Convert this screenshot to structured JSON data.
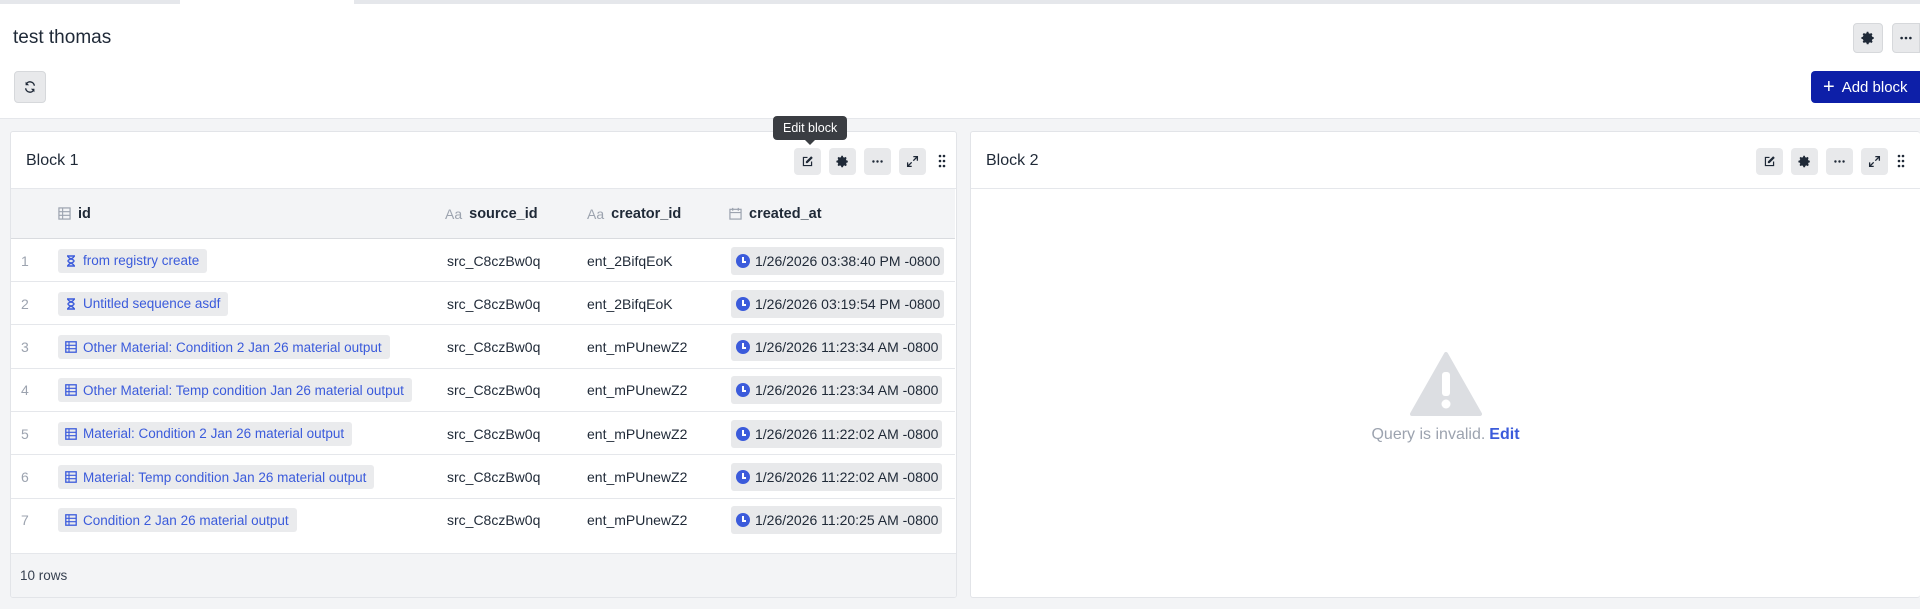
{
  "page": {
    "title": "test thomas",
    "add_block_label": "Add block",
    "accent": "#0d1fa8"
  },
  "tooltip": "Edit block",
  "block1": {
    "title": "Block 1",
    "columns": [
      {
        "label": "id",
        "icon": "table-icon"
      },
      {
        "label": "source_id",
        "icon": "text-type-icon"
      },
      {
        "label": "creator_id",
        "icon": "text-type-icon"
      },
      {
        "label": "created_at",
        "icon": "calendar-icon"
      }
    ],
    "rows": [
      {
        "num": "1",
        "id": "from registry create",
        "id_icon": "hourglass-icon",
        "source_id": "src_C8czBw0q",
        "creator_id": "ent_2BifqEoK",
        "created_at": "1/26/2026 03:38:40 PM -0800"
      },
      {
        "num": "2",
        "id": "Untitled sequence asdf",
        "id_icon": "hourglass-icon",
        "source_id": "src_C8czBw0q",
        "creator_id": "ent_2BifqEoK",
        "created_at": "1/26/2026 03:19:54 PM -0800"
      },
      {
        "num": "3",
        "id": "Other Material: Condition 2 Jan 26 material output",
        "id_icon": "table-icon",
        "source_id": "src_C8czBw0q",
        "creator_id": "ent_mPUnewZ2",
        "created_at": "1/26/2026 11:23:34 AM -0800"
      },
      {
        "num": "4",
        "id": "Other Material: Temp condition Jan 26 material output",
        "id_icon": "table-icon",
        "source_id": "src_C8czBw0q",
        "creator_id": "ent_mPUnewZ2",
        "created_at": "1/26/2026 11:23:34 AM -0800"
      },
      {
        "num": "5",
        "id": "Material: Condition 2 Jan 26 material output",
        "id_icon": "table-icon",
        "source_id": "src_C8czBw0q",
        "creator_id": "ent_mPUnewZ2",
        "created_at": "1/26/2026 11:22:02 AM -0800"
      },
      {
        "num": "6",
        "id": "Material: Temp condition Jan 26 material output",
        "id_icon": "table-icon",
        "source_id": "src_C8czBw0q",
        "creator_id": "ent_mPUnewZ2",
        "created_at": "1/26/2026 11:22:02 AM -0800"
      },
      {
        "num": "7",
        "id": "Condition 2 Jan 26 material output",
        "id_icon": "table-icon",
        "source_id": "src_C8czBw0q",
        "creator_id": "ent_mPUnewZ2",
        "created_at": "1/26/2026 11:20:25 AM -0800"
      }
    ],
    "row_count_label": "10 rows"
  },
  "block2": {
    "title": "Block 2",
    "message": "Query is invalid.",
    "edit_link": "Edit"
  }
}
